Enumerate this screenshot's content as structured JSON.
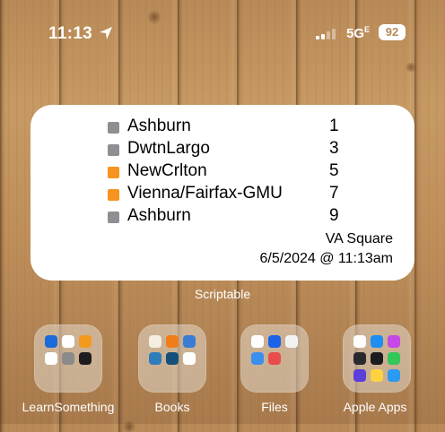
{
  "status_bar": {
    "time": "11:13",
    "network": "5G",
    "network_suffix": "E",
    "battery": "92"
  },
  "widget": {
    "app_name": "Scriptable",
    "trains": [
      {
        "station": "Ashburn",
        "minutes": "1",
        "line_color": "#8e8e93"
      },
      {
        "station": "DwtnLargo",
        "minutes": "3",
        "line_color": "#8e8e93"
      },
      {
        "station": "NewCrlton",
        "minutes": "5",
        "line_color": "#f7941d"
      },
      {
        "station": "Vienna/Fairfax-GMU",
        "minutes": "7",
        "line_color": "#f7941d"
      },
      {
        "station": "Ashburn",
        "minutes": "9",
        "line_color": "#8e8e93"
      }
    ],
    "station_name": "VA Square",
    "updated": "6/5/2024 @ 11:13am"
  },
  "dock_folders": [
    {
      "label": "LearnSomething"
    },
    {
      "label": "Books"
    },
    {
      "label": "Files"
    },
    {
      "label": "Apple Apps"
    }
  ]
}
